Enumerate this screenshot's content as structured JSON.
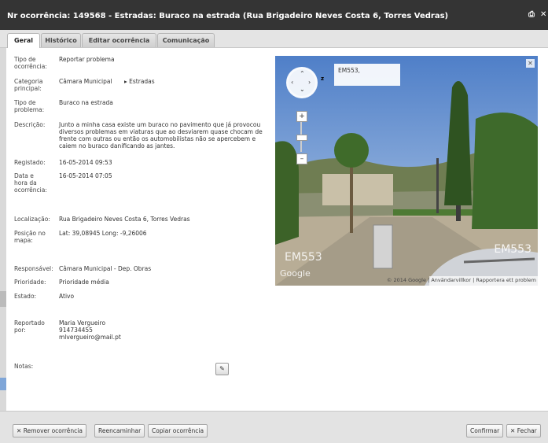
{
  "window": {
    "title": "Nr ocorrência: 149568 - Estradas: Buraco na estrada (Rua Brigadeiro Neves Costa 6, Torres Vedras)"
  },
  "tabs": [
    "Geral",
    "Histórico",
    "Editar ocorrência",
    "Comunicação"
  ],
  "details": {
    "tipo_label": "Tipo de ocorrência:",
    "tipo_value": "Reportar problema",
    "categoria_label": "Categoria principal:",
    "categoria_value": "Câmara Municipal",
    "subcategoria_value": "Estradas",
    "problema_label": "Tipo de problema:",
    "problema_value": "Buraco na estrada",
    "descricao_label": "Descrição:",
    "descricao_lines": [
      "Junto a minha casa existe um buraco no pavimento que já provocou",
      "diversos problemas em viaturas que ao desviarem quase chocam de",
      "frente com outras ou então os automobilistas não se apercebem e",
      "caiem no buraco danificando as jantes."
    ],
    "registado_label": "Registado:",
    "registado_value": "16-05-2014 09:53",
    "datahora_label": "Data e hora da ocorrência:",
    "datahora_value": "16-05-2014 07:05",
    "localizacao_label": "Localização:",
    "localizacao_value": "Rua Brigadeiro Neves Costa 6, Torres Vedras",
    "posicao_label": "Posição no mapa:",
    "posicao_value": "Lat: 39,08945 Long: -9,26006",
    "responsavel_label": "Responsável:",
    "responsavel_value": "Câmara Municipal - Dep. Obras",
    "prioridade_label": "Prioridade:",
    "prioridade_value": "Prioridade média",
    "estado_label": "Estado:",
    "estado_value": "Ativo",
    "reportado_label": "Reportado por:",
    "reportado_name": "Maria Vergueiro",
    "reportado_phone": "914734455",
    "reportado_email": "mlvergueiro@mail.pt",
    "notas_label": "Notas:"
  },
  "map": {
    "road_label": "EM553,",
    "road_sign_left": "EM553",
    "road_sign_right": "EM553",
    "google": "Google",
    "attribution": [
      "© 2014 Google",
      "Användarvillkor",
      "Rapportera ett problem"
    ]
  },
  "footer": {
    "remove": "Remover ocorrência",
    "forward": "Reencaminhar",
    "copy": "Copiar ocorrência",
    "confirm": "Confirmar",
    "close": "Fechar"
  },
  "colors": {
    "titlebar": "#343434",
    "map_sky": "#6d93d0"
  }
}
